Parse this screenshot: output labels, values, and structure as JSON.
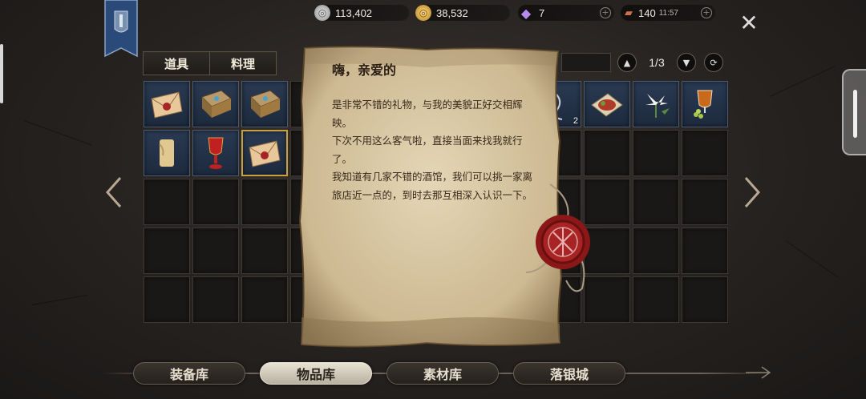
{
  "resources": [
    {
      "name": "silver",
      "value": "113,402",
      "icon": "silver-coin-icon",
      "color": "#b8b8b8"
    },
    {
      "name": "gold",
      "value": "38,532",
      "icon": "gold-coin-icon",
      "color": "#d6a93a"
    },
    {
      "name": "gem",
      "value": "7",
      "icon": "diamond-icon",
      "color": "#9b6fe0"
    },
    {
      "name": "stamina",
      "value": "140",
      "time": "11:57",
      "icon": "stamina-ticket-icon",
      "color": "#c0603a"
    }
  ],
  "tabs": [
    "道具",
    "料理"
  ],
  "pager": {
    "text": "1/3"
  },
  "letter": {
    "title": "嗨，亲爱的",
    "lines": [
      "是非常不错的礼物，与我的美貌正好交相辉映。",
      "下次不用这么客气啦，直接当面来找我就行了。",
      "我知道有几家不错的酒馆，我们可以挑一家离旅店近一点的，到时去那互相深入认识一下。"
    ]
  },
  "items": {
    "qty_badge": "2"
  },
  "bottom_nav": [
    "装备库",
    "物品库",
    "素材库",
    "落银城"
  ],
  "colors": {
    "accent": "#c8a040",
    "slot_filled": "#24344a",
    "parchment": "#d8c8a4",
    "seal": "#9a1c1c"
  }
}
